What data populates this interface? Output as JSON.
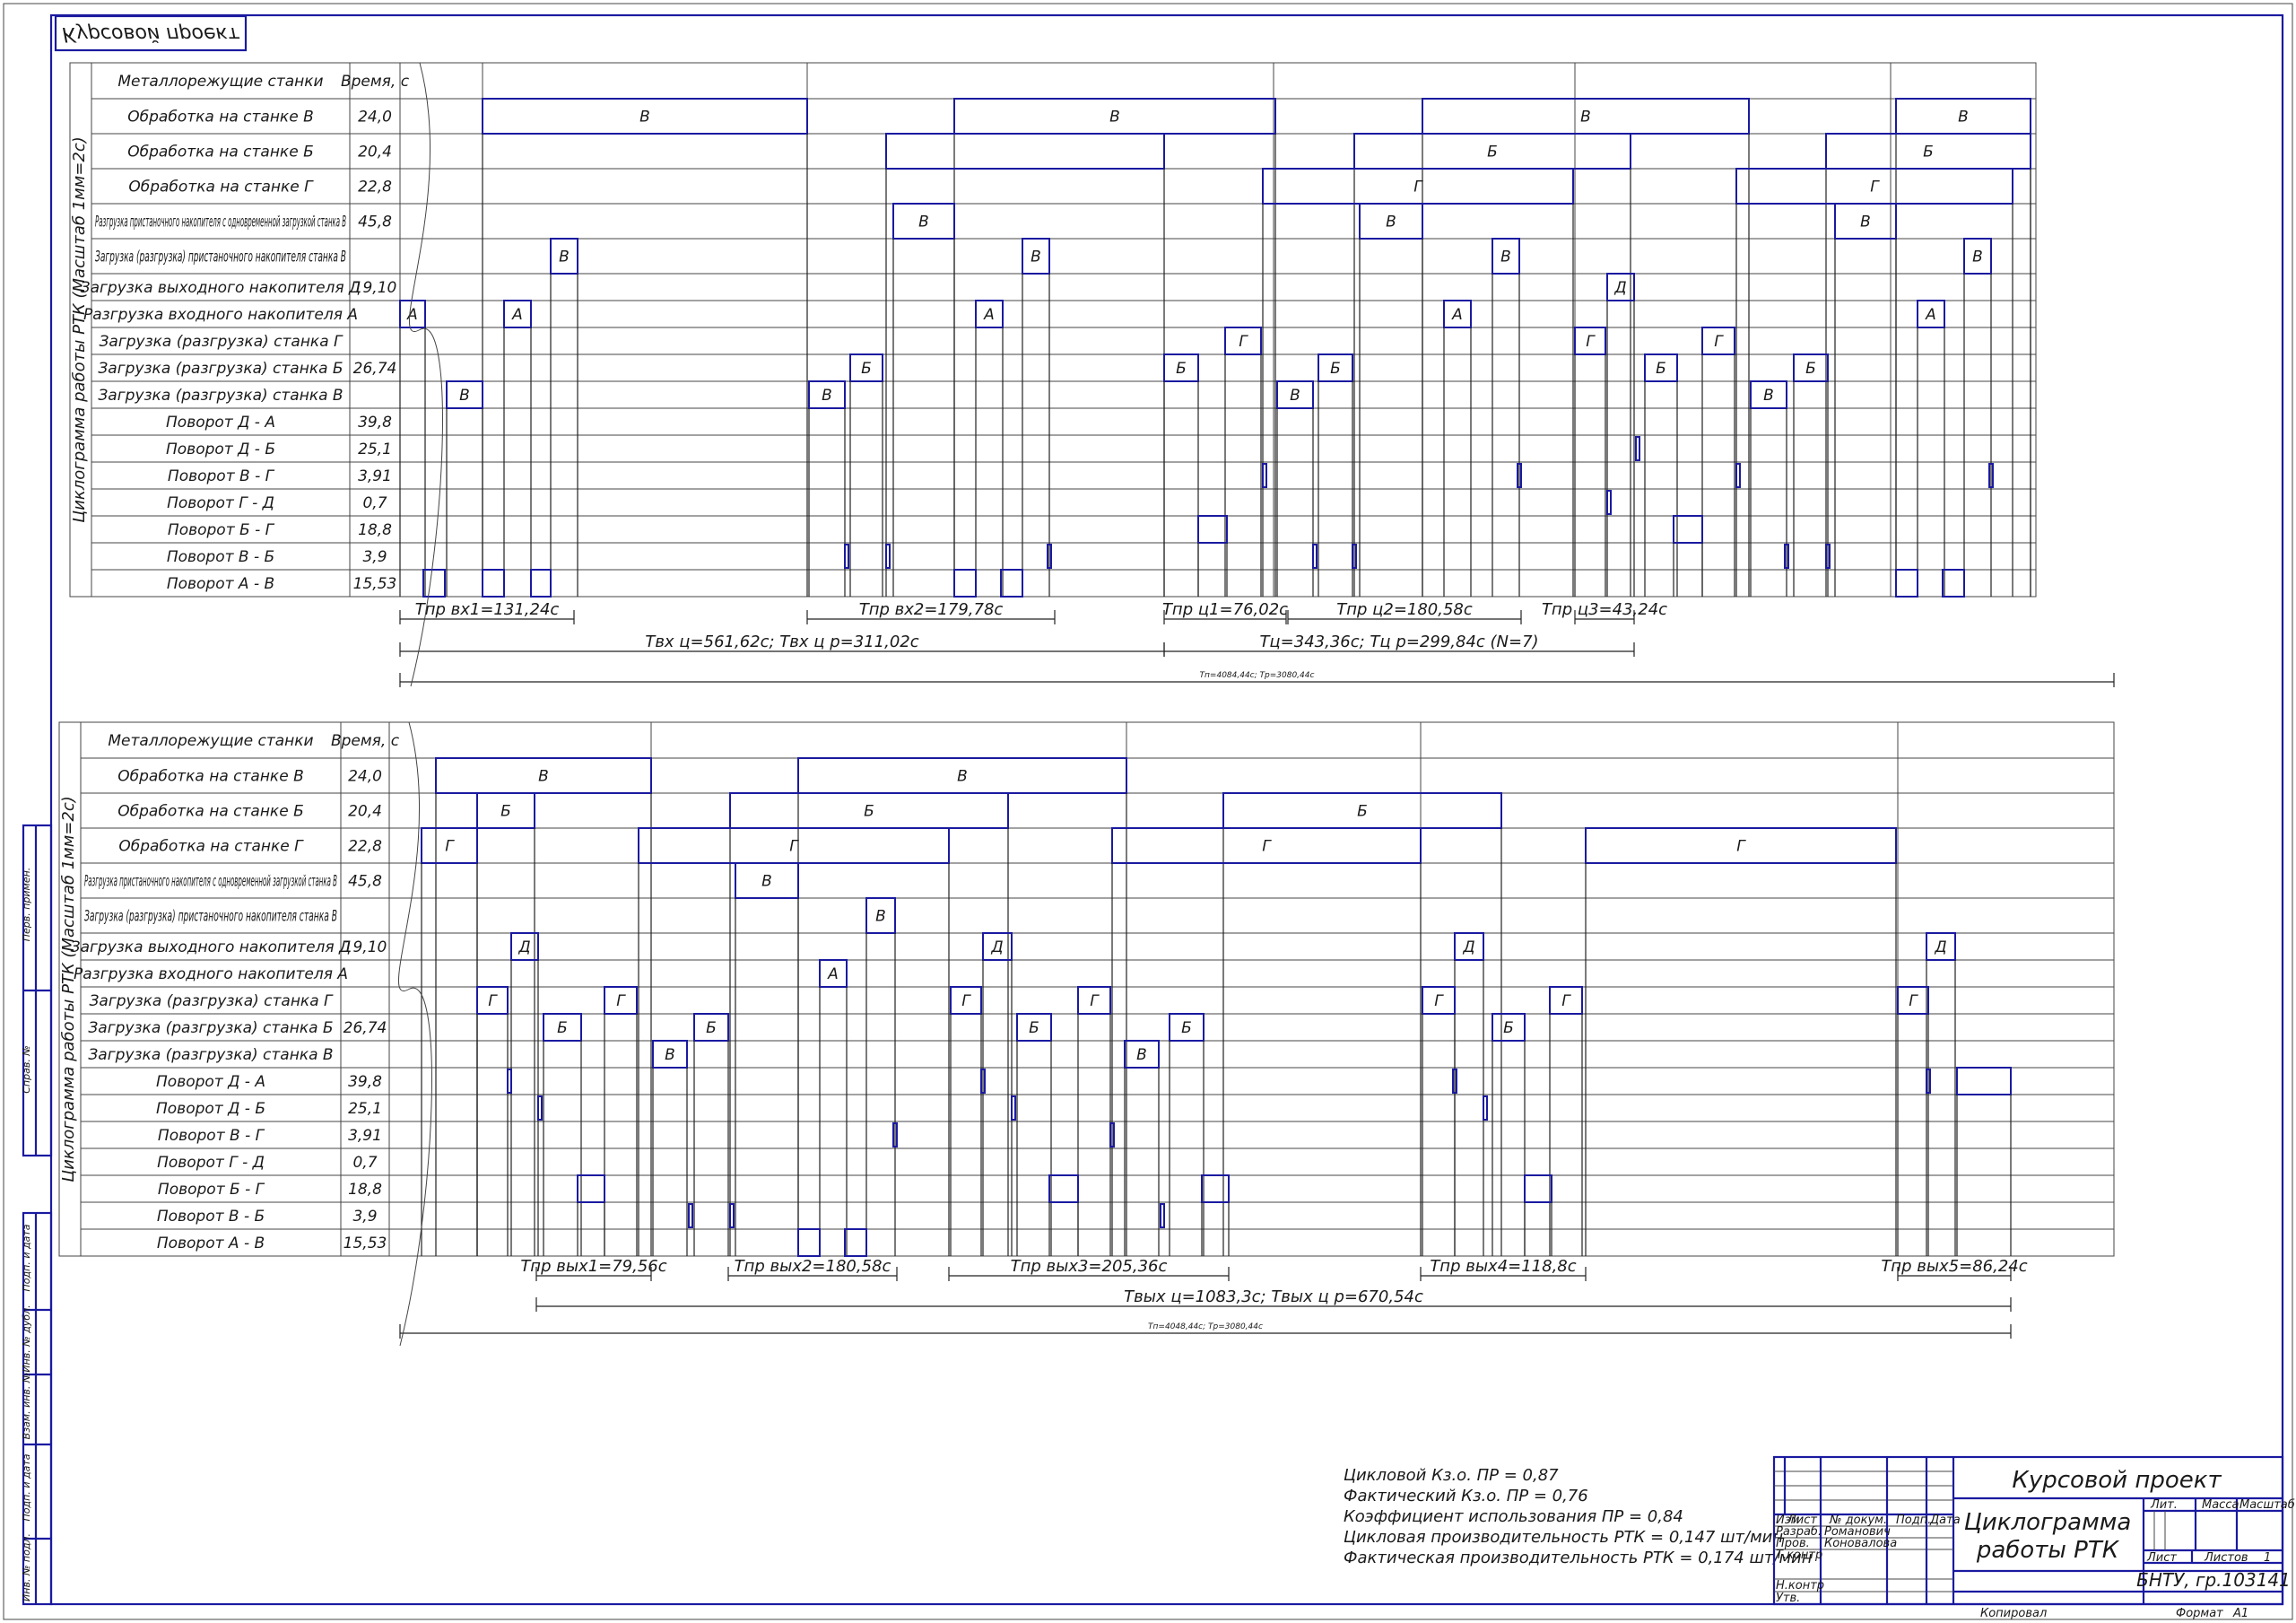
{
  "stamp_top": "Курсовой проект",
  "diagrams": [
    {
      "vertical_title": "Циклограмма работы РТК (Масштаб 1мм=2с)",
      "header": {
        "label": "Металлорежущие станки",
        "time": "Время, с"
      },
      "rows": [
        {
          "label": "Обработка на станке В",
          "time": "24,0"
        },
        {
          "label": "Обработка на станке Б",
          "time": "20,4"
        },
        {
          "label": "Обработка на станке Г",
          "time": "22,8"
        },
        {
          "label": "Разгрузка пристаночного накопителя с одновременной загрузкой станка В",
          "time": "45,8"
        },
        {
          "label": "Загрузка (разгрузка) пристаночного накопителя станка В",
          "time": ""
        },
        {
          "label": "Загрузка выходного накопителя Д",
          "time": "19,10"
        },
        {
          "label": "Разгрузка входного накопителя А",
          "time": ""
        },
        {
          "label": "Загрузка (разгрузка) станка Г",
          "time": ""
        },
        {
          "label": "Загрузка (разгрузка) станка Б",
          "time": "26,74"
        },
        {
          "label": "Загрузка (разгрузка) станка В",
          "time": ""
        },
        {
          "label": "Поворот Д - А",
          "time": "39,8"
        },
        {
          "label": "Поворот Д - Б",
          "time": "25,1"
        },
        {
          "label": "Поворот В - Г",
          "time": "3,91"
        },
        {
          "label": "Поворот Г - Д",
          "time": "0,7"
        },
        {
          "label": "Поворот Б - Г",
          "time": "18,8"
        },
        {
          "label": "Поворот В - Б",
          "time": "3,9"
        },
        {
          "label": "Поворот А - В",
          "time": "15,53"
        }
      ],
      "intervals": [
        "Тпр вх1=131,24с",
        "Тпр вх2=179,78с",
        "Тпр ц1=76,02с",
        "Тпр ц2=180,58с",
        "Тпр ц3=43,24с",
        "Твх ц=561,62с; Твх ц р=311,02с",
        "Тц=343,36с; Тц р=299,84с (N=7)",
        "Тп=4084,44с; Тр=3080,44с"
      ]
    },
    {
      "vertical_title": "Циклограмма работы РТК (Масштаб 1мм=2с)",
      "header": {
        "label": "Металлорежущие станки",
        "time": "Время, с"
      },
      "rows": [
        {
          "label": "Обработка на станке В",
          "time": "24,0"
        },
        {
          "label": "Обработка на станке Б",
          "time": "20,4"
        },
        {
          "label": "Обработка на станке Г",
          "time": "22,8"
        },
        {
          "label": "Разгрузка пристаночного накопителя с одновременной загрузкой станка В",
          "time": "45,8"
        },
        {
          "label": "Загрузка (разгрузка) пристаночного накопителя станка В",
          "time": ""
        },
        {
          "label": "Загрузка выходного накопителя Д",
          "time": "19,10"
        },
        {
          "label": "Разгрузка входного накопителя А",
          "time": ""
        },
        {
          "label": "Загрузка (разгрузка) станка Г",
          "time": ""
        },
        {
          "label": "Загрузка (разгрузка) станка Б",
          "time": "26,74"
        },
        {
          "label": "Загрузка (разгрузка) станка В",
          "time": ""
        },
        {
          "label": "Поворот Д - А",
          "time": "39,8"
        },
        {
          "label": "Поворот Д - Б",
          "time": "25,1"
        },
        {
          "label": "Поворот В - Г",
          "time": "3,91"
        },
        {
          "label": "Поворот Г - Д",
          "time": "0,7"
        },
        {
          "label": "Поворот Б - Г",
          "time": "18,8"
        },
        {
          "label": "Поворот В - Б",
          "time": "3,9"
        },
        {
          "label": "Поворот А - В",
          "time": "15,53"
        }
      ],
      "intervals": [
        "Тпр вых1=79,56с",
        "Тпр вых2=180,58с",
        "Тпр вых3=205,36с",
        "Тпр вых4=118,8с",
        "Тпр вых5=86,24с",
        "Твых ц=1083,3с; Твых ц р=670,54с",
        "Тп=4048,44с; Тр=3080,44с"
      ]
    }
  ],
  "notes": [
    "Цикловой Кз.о. ПР = 0,87",
    "Фактический Кз.о. ПР = 0,76",
    "Коэффициент использования ПР = 0,84",
    "Цикловая производительность РТК = 0,147 шт/мин",
    "Фактическая производительность РТК = 0,174 шт/мин"
  ],
  "title_block": {
    "project": "Курсовой проект",
    "title_line1": "Циклограмма",
    "title_line2": "работы РТК",
    "col_izm": "Изм",
    "col_list": "Лист",
    "col_docnum": "№ докум.",
    "col_sign": "Подп.",
    "col_date": "Дата",
    "razrab": "Разраб.",
    "razrab_name": "Романович",
    "prov": "Пров.",
    "prov_name": "Коновалова",
    "tkontr": "Т.контр",
    "nkontr": "Н.контр",
    "utv": "Утв.",
    "lit": "Лит.",
    "massa": "Масса",
    "masshtab": "Масштаб",
    "list": "Лист",
    "listov": "Листов",
    "listov_val": "1",
    "org": "БНТУ, гр.103141",
    "kopiroval": "Копировал",
    "format": "Формат",
    "format_val": "А1"
  },
  "side_stamps": [
    "Перв. примен.",
    "Справ. №",
    "Подп. и дата",
    "Инв. № дубл.",
    "Взам. инв. №",
    "Подп. и дата",
    "Инв. № подл."
  ]
}
